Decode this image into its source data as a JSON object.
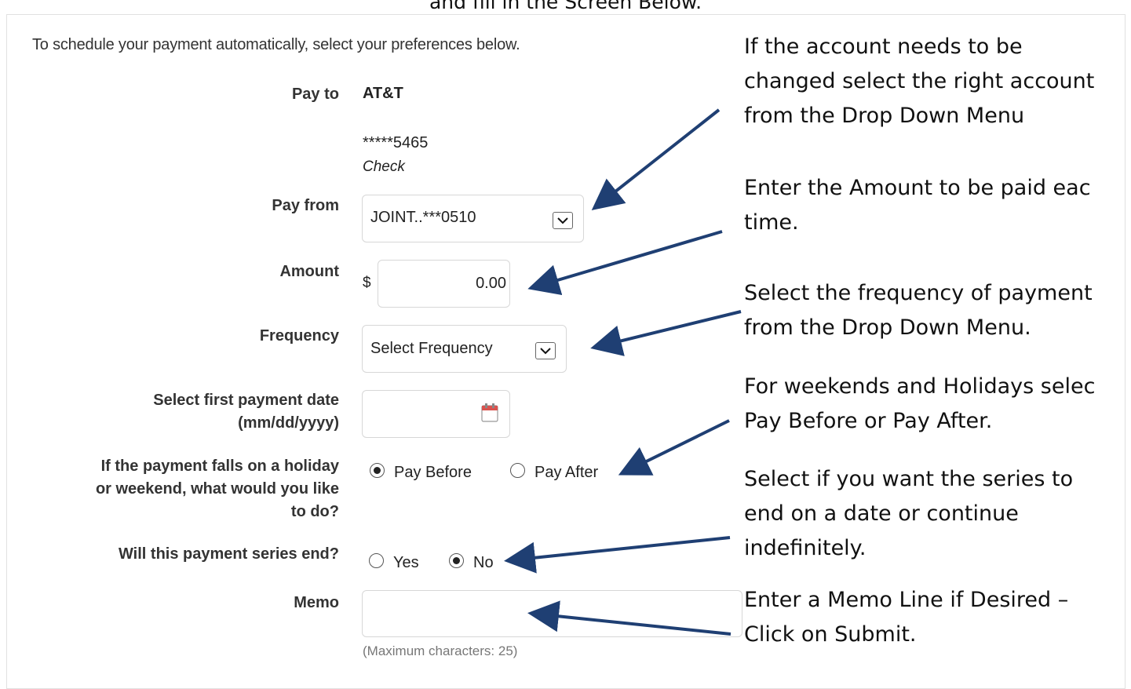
{
  "caption": "and fill in the Screen Below.",
  "intro": "To schedule your payment automatically, select your preferences below.",
  "payee": {
    "label": "Pay to",
    "name": "AT&T",
    "account": "*****5465",
    "method": "Check"
  },
  "pay_from": {
    "label": "Pay from",
    "value": "JOINT..***0510",
    "icon": "chevron-down-icon"
  },
  "amount": {
    "label": "Amount",
    "currency": "$",
    "value": "0.00"
  },
  "frequency": {
    "label": "Frequency",
    "value": "Select Frequency",
    "icon": "chevron-down-icon"
  },
  "first_date": {
    "label_line1": "Select first payment date",
    "label_line2": "(mm/dd/yyyy)",
    "value": "",
    "icon": "calendar-icon"
  },
  "holiday": {
    "label_line1": "If the payment falls on a holiday",
    "label_line2": "or weekend, what would you like",
    "label_line3": "to do?",
    "options": [
      {
        "label": "Pay Before",
        "selected": true
      },
      {
        "label": "Pay After",
        "selected": false
      }
    ]
  },
  "series_end": {
    "label": "Will this payment series end?",
    "options": [
      {
        "label": "Yes",
        "selected": false
      },
      {
        "label": "No",
        "selected": true
      }
    ]
  },
  "memo": {
    "label": "Memo",
    "value": "",
    "hint": "(Maximum characters: 25)"
  },
  "annotations": {
    "account": [
      "If the account needs to be",
      "changed select the right account",
      "from the Drop Down Menu"
    ],
    "amount": [
      "Enter the Amount to be paid eac",
      "time."
    ],
    "frequency": [
      "Select the frequency of payment",
      "from the Drop Down Menu."
    ],
    "weekend": [
      "For weekends and Holidays selec",
      "Pay Before or Pay After."
    ],
    "series": [
      "Select if you want the series to",
      "end on a date or continue",
      "indefinitely."
    ],
    "memo": [
      "Enter a Memo Line if Desired –",
      "Click on Submit."
    ]
  },
  "colors": {
    "arrow": "#1f3f73",
    "field_border": "#d7d7d7",
    "label": "#333333"
  }
}
